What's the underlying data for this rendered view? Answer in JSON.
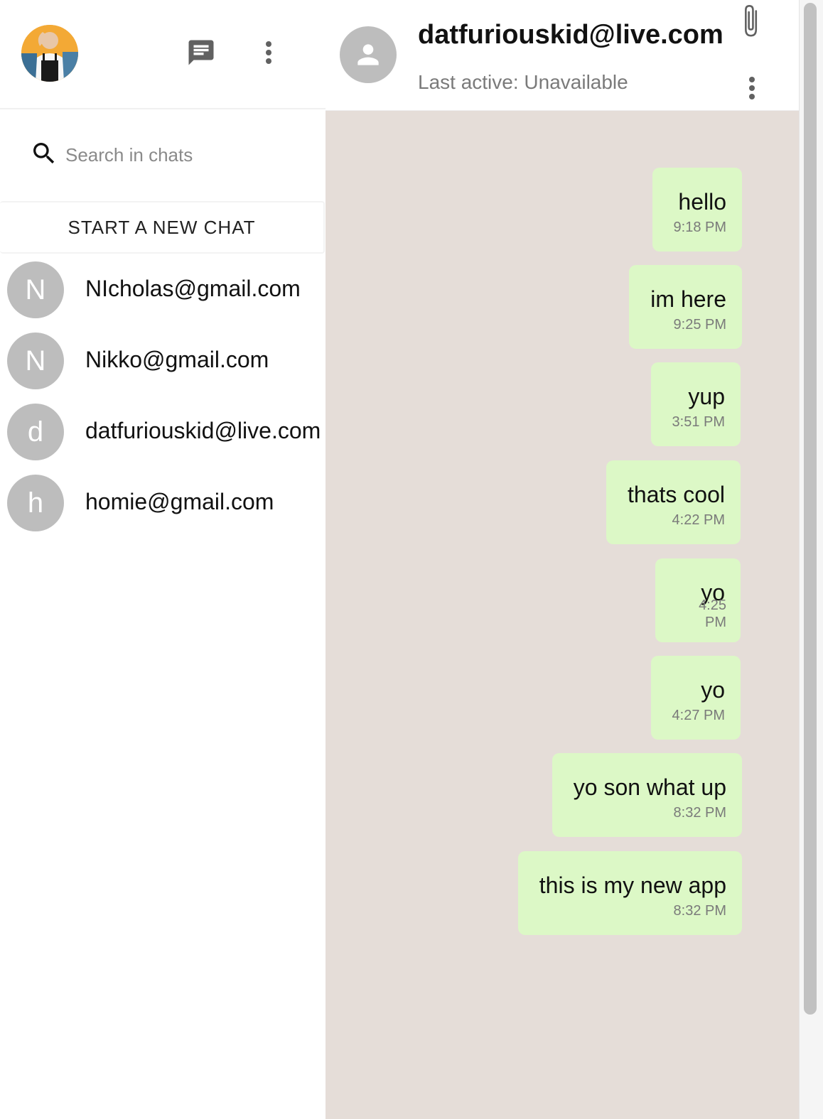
{
  "sidebar": {
    "header": {
      "avatar_icon": "user-photo-avatar",
      "new_chat_icon": "chat-message-icon",
      "more_icon": "more-vertical-icon"
    },
    "search": {
      "placeholder": "Search in chats",
      "value": ""
    },
    "new_chat_label": "START A NEW CHAT",
    "chats": [
      {
        "initial": "N",
        "name": "NIcholas@gmail.com"
      },
      {
        "initial": "N",
        "name": "Nikko@gmail.com"
      },
      {
        "initial": "d",
        "name": "datfuriouskid@live.com"
      },
      {
        "initial": "h",
        "name": "homie@gmail.com"
      }
    ]
  },
  "conversation": {
    "contact_name": "datfuriouskid@live.com",
    "last_active": "Last active: Unavailable",
    "messages": [
      {
        "text": "hello",
        "time": "9:18 PM"
      },
      {
        "text": "im here",
        "time": "9:25 PM"
      },
      {
        "text": "yup",
        "time": "3:51 PM"
      },
      {
        "text": "thats cool",
        "time": "4:22 PM"
      },
      {
        "text": "yo",
        "time": "4:25 PM"
      },
      {
        "text": "yo",
        "time": "4:27 PM"
      },
      {
        "text": "yo son what up",
        "time": "8:32 PM"
      },
      {
        "text": "this is my new app",
        "time": "8:32 PM"
      }
    ]
  },
  "colors": {
    "sent_bubble": "#dcf8c6",
    "chat_background": "#e5ddd8",
    "avatar_gray": "#bdbdbd"
  }
}
